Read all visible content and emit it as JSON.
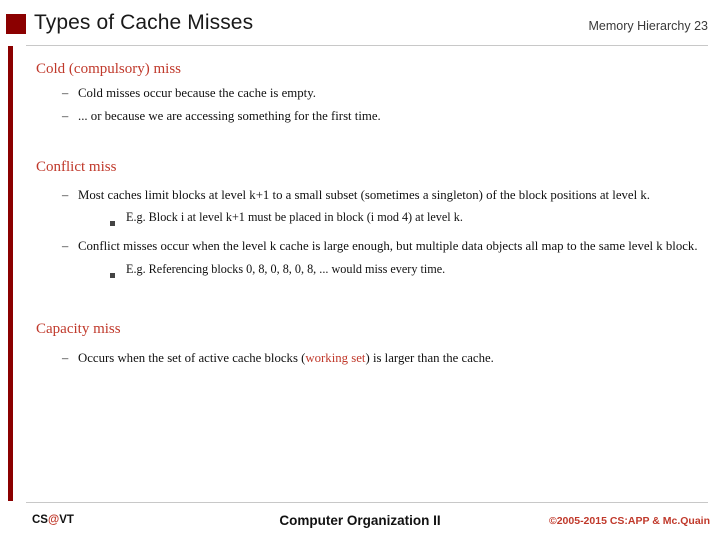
{
  "header": {
    "title": "Types of Cache Misses",
    "right": "Memory Hierarchy 23",
    "square_color": "#8b0000"
  },
  "content": {
    "sections": [
      {
        "heading": "Cold (compulsory) miss",
        "bullets": [
          {
            "dash": "–",
            "text": "Cold misses occur because the cache is empty."
          },
          {
            "dash": "–",
            "text": "... or because we are accessing something for the first time."
          }
        ]
      },
      {
        "heading": "Conflict miss",
        "bullets": [
          {
            "dash": "–",
            "text": "Most caches limit blocks at level k+1 to a small subset (sometimes a singleton) of the block positions at level k."
          },
          {
            "dash": "–",
            "text": "Conflict misses occur when the level k cache is large enough, but multiple data objects all map to the same level k block."
          }
        ],
        "subbullets": [
          {
            "after": 0,
            "text": "E.g. Block i at level k+1 must be placed in block (i mod 4) at level k."
          },
          {
            "after": 1,
            "text": "E.g. Referencing blocks 0, 8, 0, 8, 0, 8, ... would miss every time."
          }
        ]
      },
      {
        "heading": "Capacity miss",
        "bullets": [
          {
            "dash": "–",
            "text_before": "Occurs when the set of active cache blocks (",
            "text_accent": "working set",
            "text_after": ") is larger than the cache."
          }
        ]
      }
    ]
  },
  "footer": {
    "left_prefix": "CS",
    "left_at": "@",
    "left_suffix": "VT",
    "center": "Computer Organization II",
    "right": "©2005-2015 CS:APP & Mc.Quain",
    "accent_color": "#c0392b"
  }
}
